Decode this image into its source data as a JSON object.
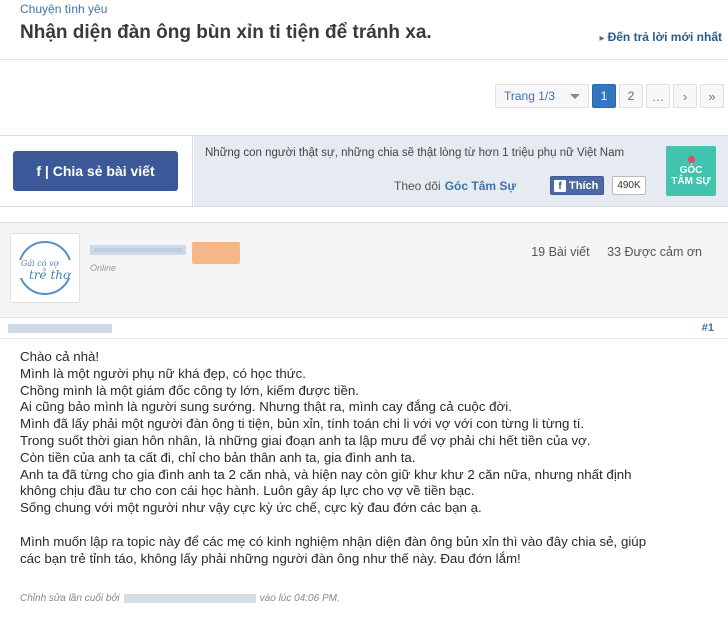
{
  "header": {
    "breadcrumb": "Chuyện tình yêu",
    "title": "Nhận diện đàn ông bùn xỉn ti tiện để tránh xa.",
    "reply_link": "Đến trả lời mới nhất"
  },
  "pagination": {
    "label": "Trang 1/3",
    "pages": [
      "1",
      "2"
    ],
    "current": "1",
    "ellipsis": "…",
    "next_glyph": "›",
    "last_glyph": "»"
  },
  "share": {
    "button_label": "f | Chia sẻ bài viết",
    "promo_text": "Những con người thật sự, những chia sẽ thật lòng từ hơn 1 triệu phụ nữ Việt Nam",
    "follow_label": "Theo dõi",
    "page_name": "Góc Tâm Sự",
    "like_label": "Thích",
    "like_count": "490K",
    "logo_line1": "GÓC",
    "logo_line2": "TÂM SỰ"
  },
  "post": {
    "online": "Online",
    "stats_posts": "19 Bài viết",
    "stats_thanks": "33 Được cảm ơn",
    "number": "#1",
    "avatar_text_line1": "Gái có vợ",
    "avatar_text_line2": "trẻ thơ",
    "body_lines": [
      "Chào cả nhà!",
      "Mình là một người phụ nữ khá đẹp, có học thức.",
      "Chồng mình là một giám đốc công ty lớn, kiếm được tiền.",
      "Ai cũng bảo mình là người sung sướng. Nhưng thật ra, mình cay đắng cả cuộc đời.",
      "Mình đã lấy phải một người đàn ông ti tiện, bủn xỉn, tính toán chi li với vợ với con từng li từng tí.",
      "Trong suốt thời gian hôn nhân, là những giai đoạn anh ta lập mưu để vợ phải chi hết tiền của vợ.",
      "Còn tiền của anh ta cất đi, chỉ cho bản thân anh ta, gia đình anh ta.",
      "Anh ta đã từng cho gia đình anh ta 2 căn nhà, và hiện nay còn giữ khư khư 2 căn nữa, nhưng nhất định",
      "không chịu đầu tư cho con cái học hành. Luôn gây áp lực cho vợ về tiền bạc.",
      "Sống chung với một người như vậy cực kỳ ức chế, cực kỳ đau đớn các bạn ạ."
    ],
    "body_lines_2": [
      "Mình muốn lập ra topic này để các mẹ có kinh nghiệm nhận diện đàn ông bủn xỉn thì vào đây chia sẻ, giúp",
      "các bạn trẻ tỉnh táo, không lấy phải những người đàn ông như thế này. Đau đớn lắm!"
    ],
    "edit_prefix": "Chỉnh sửa lần cuối bởi",
    "edit_suffix": "vào lúc 04:06 PM."
  },
  "colors": {
    "link_blue": "#3f72a8",
    "facebook_blue": "#3b5998",
    "pager_active": "#3576c1",
    "logo_teal": "#41c3ad"
  }
}
